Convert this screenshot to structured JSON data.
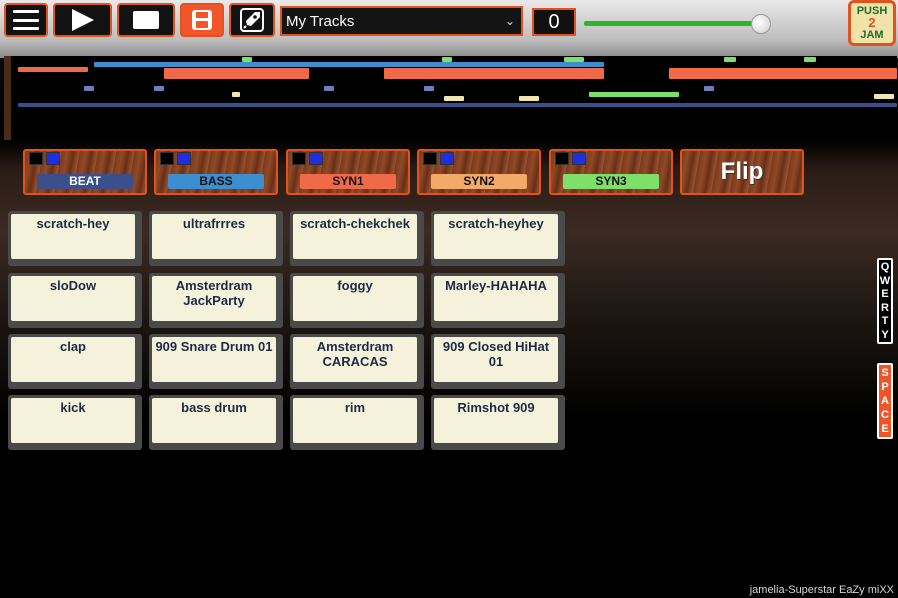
{
  "toolbar": {
    "track_select_value": "My Tracks",
    "counter": "0",
    "volume_level": 0.92
  },
  "logo": {
    "line1": "PUSH",
    "line2": "2",
    "line3": "JAM"
  },
  "instruments": [
    {
      "label": "BEAT",
      "color": "#3b4f8a"
    },
    {
      "label": "BASS",
      "color": "#3c8ed0"
    },
    {
      "label": "SYN1",
      "color": "#f06a4a"
    },
    {
      "label": "SYN2",
      "color": "#f2a96a"
    },
    {
      "label": "SYN3",
      "color": "#7ee06a"
    }
  ],
  "flip_label": "Flip",
  "pads": [
    [
      "scratch-hey",
      "ultrafrrres",
      "scratch-chekchek",
      "scratch-heyhey"
    ],
    [
      "sloDow",
      "Amsterdram JackParty",
      "foggy",
      "Marley-HAHAHA"
    ],
    [
      "clap",
      "909 Snare Drum 01",
      "Amsterdram CARACAS",
      "909 Closed HiHat 01"
    ],
    [
      "kick",
      "bass drum",
      "rim",
      "Rimshot 909"
    ]
  ],
  "side_buttons": {
    "qwerty": "QWERTY",
    "space": "SPACE"
  },
  "credit": "jamelia-Superstar EaZy miXX"
}
